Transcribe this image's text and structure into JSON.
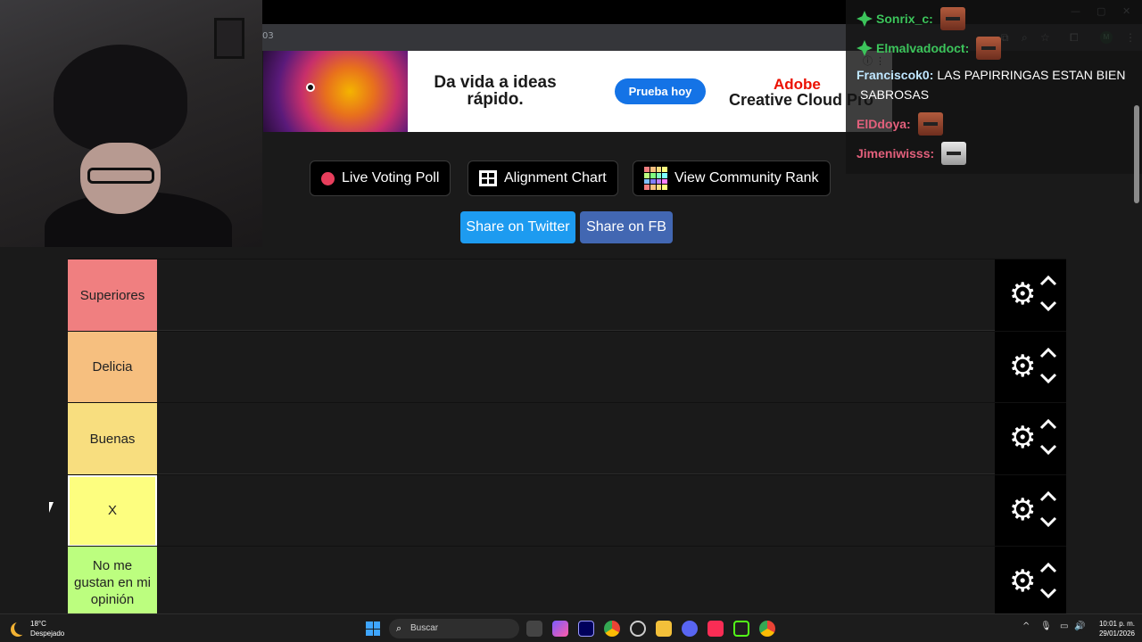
{
  "browser": {
    "url_fragment": "03"
  },
  "ad": {
    "tagline": "Da vida a ideas rápido.",
    "cta": "Prueba hoy",
    "brand_top": "Adobe",
    "brand_bottom": "Creative Cloud Pro",
    "info_icon": "ⓘ ⋮"
  },
  "actions": {
    "live_poll": "Live Voting Poll",
    "alignment_chart": "Alignment Chart",
    "community_rank": "View Community Rank",
    "share_twitter": "Share on Twitter",
    "share_fb": "Share on FB"
  },
  "tiers": [
    {
      "label": "Superiores",
      "color": "#f07f80"
    },
    {
      "label": "Delicia",
      "color": "#f6bf7f"
    },
    {
      "label": "Buenas",
      "color": "#f8de7f"
    },
    {
      "label": "X",
      "color": "#fdfe7f",
      "selected": true
    },
    {
      "label": "No me gustan en mi opinión",
      "color": "#bcfe7f"
    }
  ],
  "chat": [
    {
      "user": "Sonrix_c:",
      "color": "#3cc45b",
      "badge": true,
      "message": "",
      "emote": "face-emote"
    },
    {
      "user": "Elmalvadodoct:",
      "color": "#3cc45b",
      "badge": true,
      "message": "",
      "emote": "face-emote"
    },
    {
      "user": "Franciscok0:",
      "color": "#bfe6ff",
      "badge": false,
      "message": "LAS PAPIRRINGAS ESTAN BIEN",
      "emote": ""
    },
    {
      "user": "",
      "color": "#ffffff",
      "badge": false,
      "message": "SABROSAS",
      "emote": ""
    },
    {
      "user": "ElDdoya:",
      "color": "#e3607c",
      "badge": false,
      "message": "",
      "emote": "face-emote"
    },
    {
      "user": "Jimeniwisss:",
      "color": "#e3607c",
      "badge": false,
      "message": "",
      "emote": "cat-emote"
    }
  ],
  "taskbar": {
    "temperature": "18°C",
    "weather": "Despejado",
    "search_placeholder": "Buscar",
    "time": "10:01 p. m.",
    "date": "29/01/2026"
  }
}
